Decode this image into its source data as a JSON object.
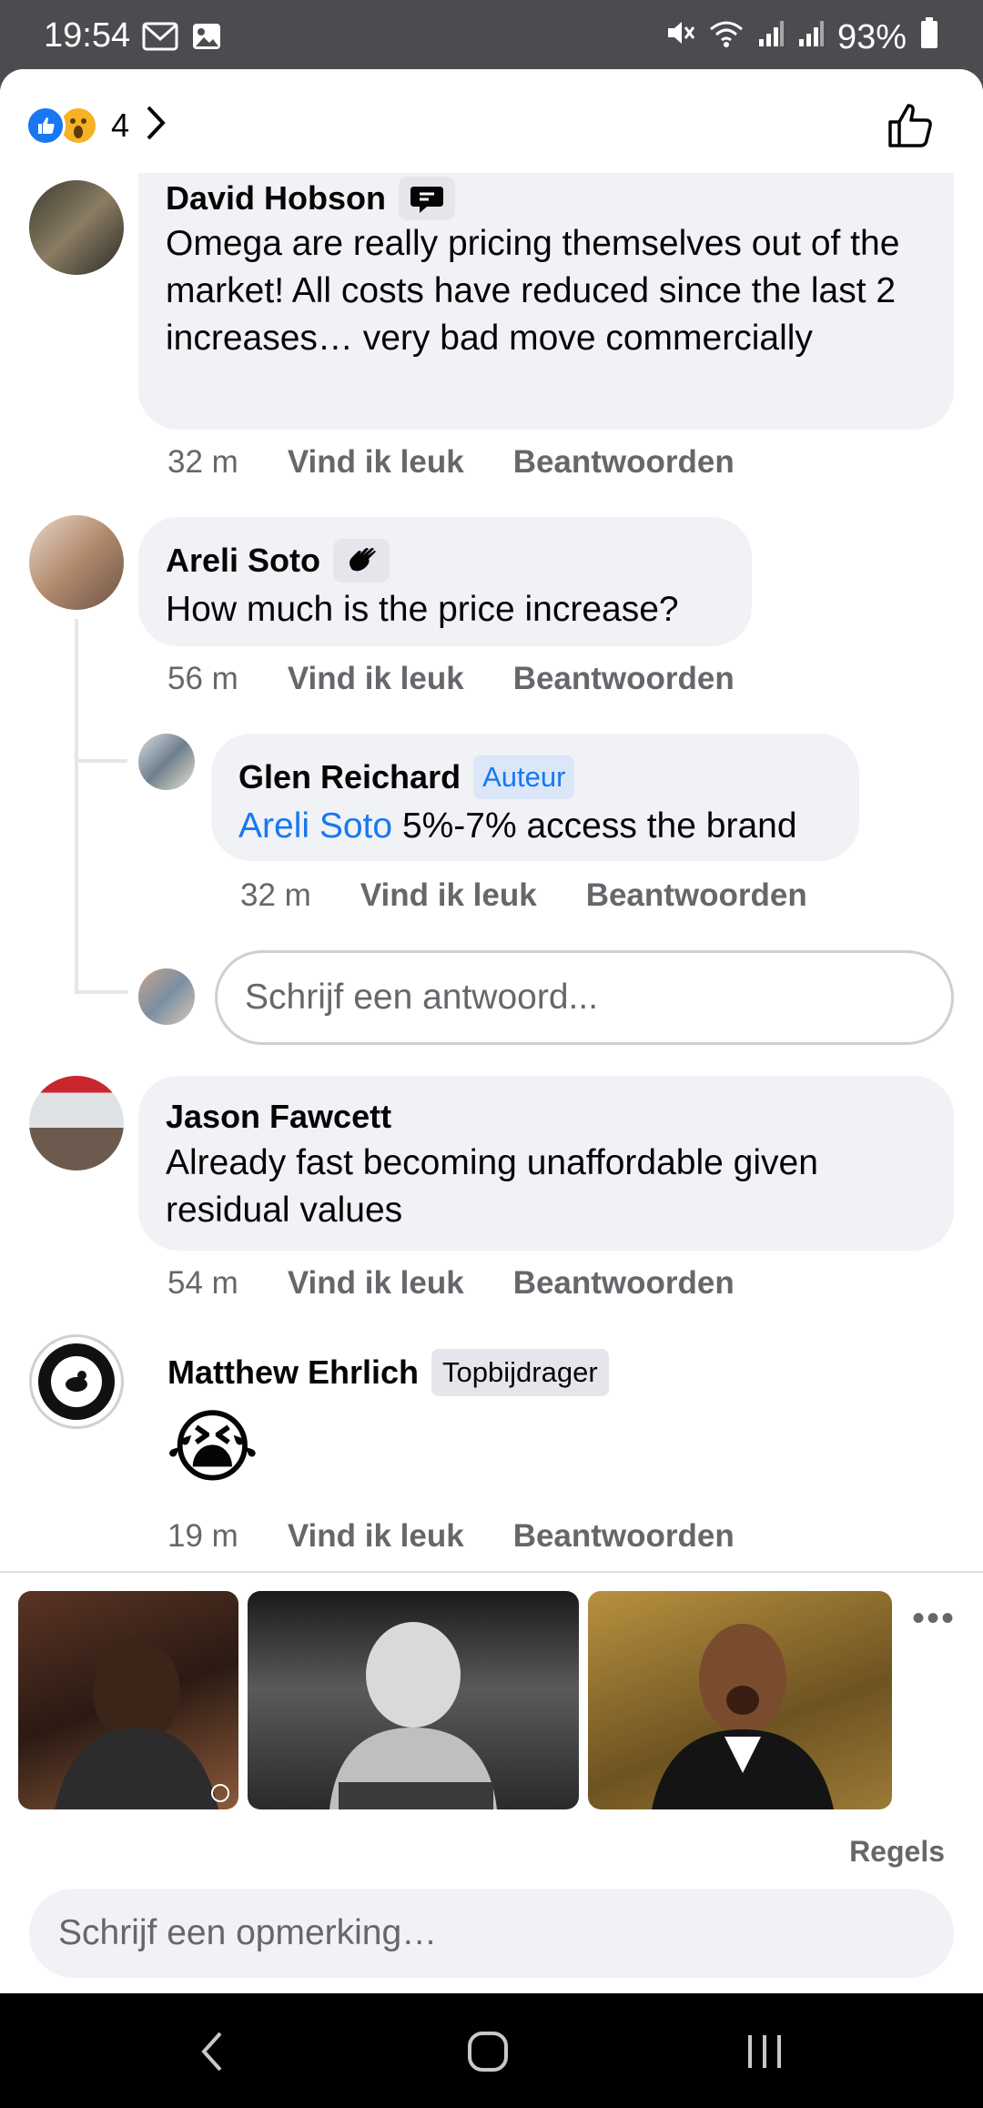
{
  "status_bar": {
    "time": "19:54",
    "battery": "93%",
    "left_icons": [
      "gmail-icon",
      "gallery-icon"
    ],
    "right_icons": [
      "mute-icon",
      "wifi-icon",
      "signal-icon",
      "signal-icon",
      "battery-icon"
    ]
  },
  "header": {
    "reaction_count": "4",
    "reaction_icons": [
      "like-reaction-icon",
      "wow-reaction-icon"
    ]
  },
  "comments": [
    {
      "author": "David Hobson",
      "badge_icon": "conversation-starter-icon",
      "text": "Omega are really pricing themselves out of the market! All costs have reduced since the last 2 increases… very bad move commercially",
      "time": "32 m",
      "like": "Vind ik leuk",
      "reply": "Beantwoorden"
    },
    {
      "author": "Areli Soto",
      "badge_icon": "wave-icon",
      "text": "How much is the price increase?",
      "time": "56 m",
      "like": "Vind ik leuk",
      "reply": "Beantwoorden"
    },
    {
      "author": "Glen Reichard",
      "badge": "Auteur",
      "mention": "Areli Soto",
      "text": "5%-7% access the brand",
      "time": "32 m",
      "like": "Vind ik leuk",
      "reply": "Beantwoorden"
    },
    {
      "author": "Jason Fawcett",
      "text": "Already fast becoming unaffordable given residual values",
      "time": "54 m",
      "like": "Vind ik leuk",
      "reply": "Beantwoorden"
    },
    {
      "author": "Matthew Ehrlich",
      "badge": "Topbijdrager",
      "emoji": "😭",
      "time": "19 m",
      "like": "Vind ik leuk",
      "reply": "Beantwoorden"
    }
  ],
  "reply_placeholder": "Schrijf een antwoord...",
  "gif_picker": {
    "more": "•••",
    "rules": "Regels"
  },
  "comment_placeholder": "Schrijf een opmerking…",
  "colors": {
    "accent": "#1877f2",
    "bubble": "#f0f2f5",
    "secondary_text": "#65676b"
  }
}
